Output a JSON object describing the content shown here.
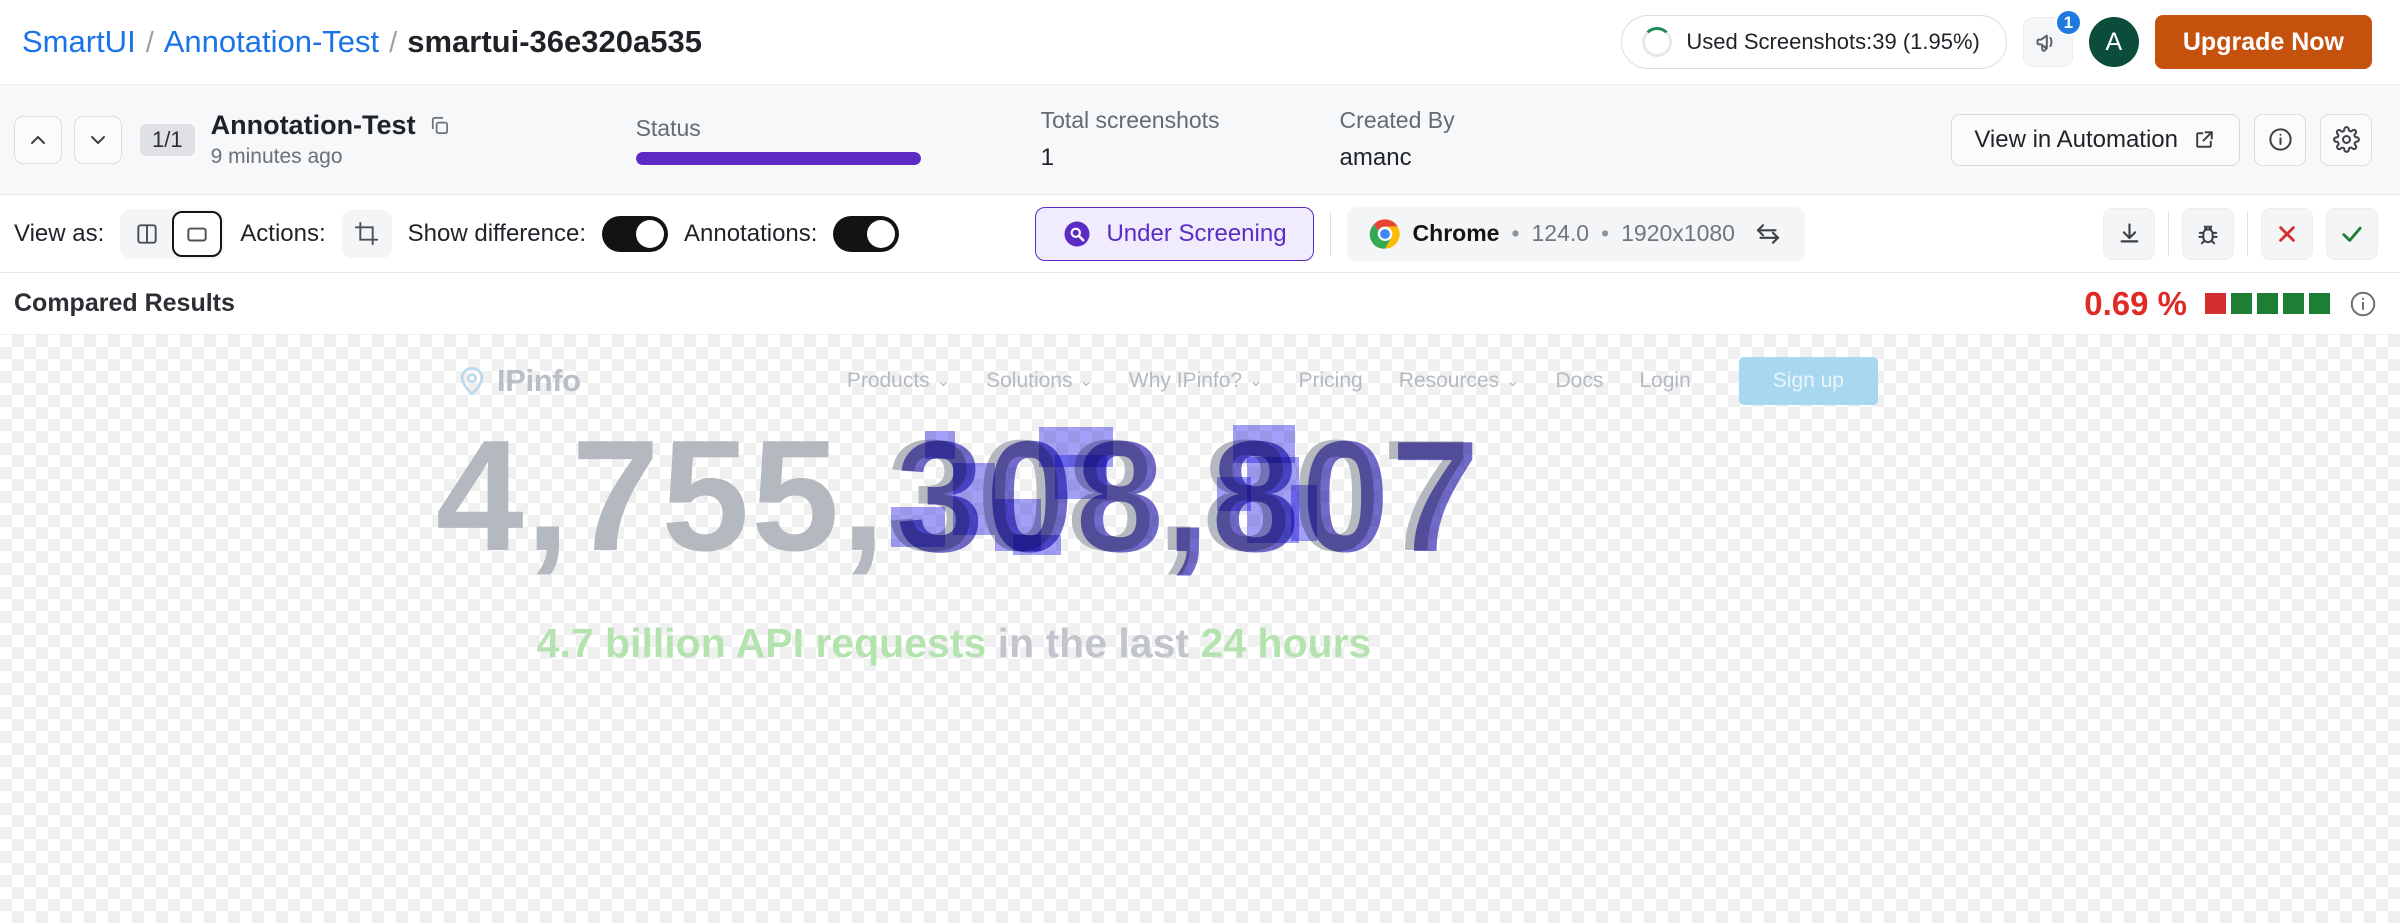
{
  "header": {
    "breadcrumb": {
      "root": "SmartUI",
      "project": "Annotation-Test",
      "current": "smartui-36e320a535",
      "separator": "/"
    },
    "usage": {
      "label": "Used Screenshots:39 (1.95%)",
      "ring_icon": "usage-ring-icon"
    },
    "announcement": {
      "icon": "megaphone-icon",
      "badge": "1"
    },
    "avatar": {
      "initial": "A",
      "color": "#0b4c3a"
    },
    "upgrade_button": {
      "label": "Upgrade Now",
      "color": "#c4510c"
    }
  },
  "metabar": {
    "prev_icon": "chevron-up-icon",
    "next_icon": "chevron-down-icon",
    "page_badge": "1/1",
    "build_title": "Annotation-Test",
    "copy_icon": "copy-icon",
    "build_time": "9 minutes ago",
    "status": {
      "label": "Status",
      "progress_percent": 100,
      "color": "#5b2bc4"
    },
    "total_screenshots": {
      "label": "Total screenshots",
      "value": "1"
    },
    "created_by": {
      "label": "Created By",
      "value": "amanc"
    },
    "automation_button": {
      "label": "View in Automation",
      "icon": "external-link-icon"
    },
    "info_icon": "info-icon",
    "settings_icon": "gear-icon"
  },
  "toolbar": {
    "view_as_label": "View as:",
    "view_modes": [
      {
        "name": "split-view",
        "icon": "split-view-icon",
        "selected": false
      },
      {
        "name": "single-view",
        "icon": "single-view-icon",
        "selected": true
      }
    ],
    "actions_label": "Actions:",
    "crop_icon": "crop-icon",
    "show_difference": {
      "label": "Show difference:",
      "on": true
    },
    "annotations": {
      "label": "Annotations:",
      "on": true
    },
    "screening_status": {
      "label": "Under Screening",
      "icon": "magnifier-icon",
      "color": "#5b2bc4"
    },
    "browser": {
      "icon": "chrome-icon",
      "name": "Chrome",
      "version": "124.0",
      "resolution": "1920x1080",
      "dot": "•",
      "swap_icon": "swap-arrows-icon"
    },
    "download_icon": "download-icon",
    "bug_icon": "bug-icon",
    "reject_icon": "close-x-icon",
    "approve_icon": "check-icon"
  },
  "results": {
    "title": "Compared Results",
    "diff_percent": "0.69 %",
    "diff_color": "#e02a26",
    "squares": [
      "#d32f2f",
      "#1e7e34",
      "#1e7e34",
      "#1e7e34",
      "#1e7e34"
    ],
    "info_icon": "info-icon"
  },
  "screenshot": {
    "site_brand": "IPinfo",
    "brand_icon": "location-pin-icon",
    "nav_links": [
      {
        "label": "Products",
        "has_caret": true
      },
      {
        "label": "Solutions",
        "has_caret": true
      },
      {
        "label": "Why IPinfo?",
        "has_caret": true
      },
      {
        "label": "Pricing",
        "has_caret": false
      },
      {
        "label": "Resources",
        "has_caret": true
      },
      {
        "label": "Docs",
        "has_caret": false
      },
      {
        "label": "Login",
        "has_caret": false
      }
    ],
    "signup_label": "Sign up",
    "hero_number_plain": "4,755,",
    "hero_number_diff": "308,807",
    "hero_sub_1": "4.7 billion API requests",
    "hero_sub_2": " in the last ",
    "hero_sub_3": "24 hours"
  }
}
